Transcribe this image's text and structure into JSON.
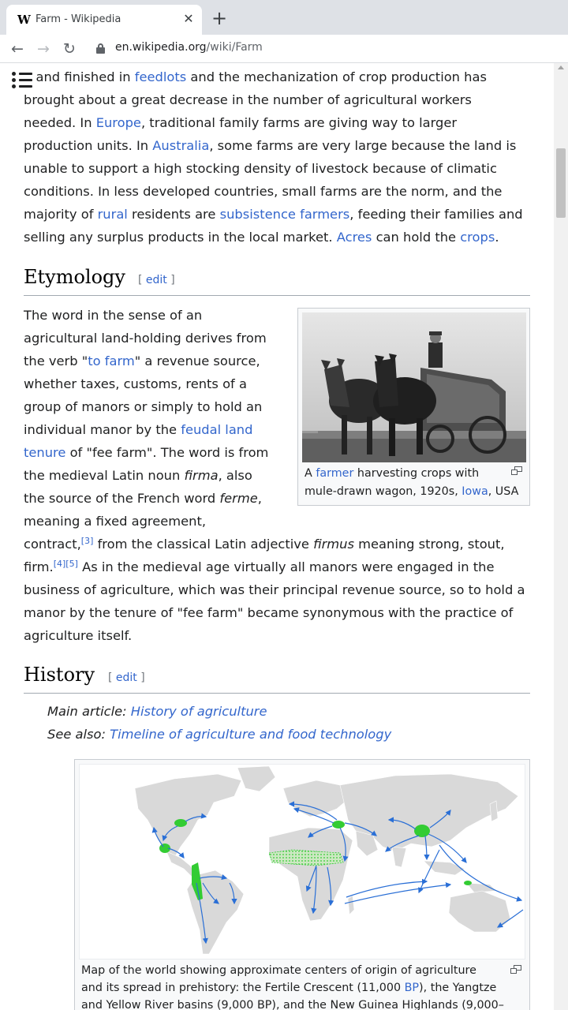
{
  "browser": {
    "tab_favicon": "W",
    "tab_title": "Farm - Wikipedia",
    "tab_close": "✕",
    "new_tab": "+",
    "back": "←",
    "forward": "→",
    "reload": "↻",
    "url_domain": "en.wikipedia.org",
    "url_path": "/wiki/Farm"
  },
  "intro": {
    "l1": [
      "d and finished in ",
      "feedlots",
      " and the mechanization of crop production has"
    ],
    "l2": "brought about a great decrease in the number of agricultural workers",
    "l3": [
      "needed. In ",
      "Europe",
      ", traditional family farms are giving way to larger"
    ],
    "l4": [
      "production units. In ",
      "Australia",
      ", some farms are very large because the land is"
    ],
    "l5": "unable to support a high stocking density of livestock because of climatic",
    "l6": "conditions. In less developed countries, small farms are the norm, and the",
    "l7": [
      "majority of ",
      "rural",
      " residents are ",
      "subsistence farmers",
      ", feeding their families and"
    ],
    "l8": [
      "selling any surplus products in the local market. ",
      "Acres",
      " can hold the ",
      "crops",
      "."
    ]
  },
  "etymology": {
    "heading": "Etymology",
    "edit_open": "[",
    "edit_label": "edit",
    "edit_close": "]",
    "n1": "The word in the sense of an",
    "n2": "agricultural land-holding derives from",
    "n3": [
      "the verb \"",
      "to farm",
      "\" a revenue source,"
    ],
    "n4": "whether taxes, customs, rents of a",
    "n5": "group of manors or simply to hold an",
    "n6": [
      "individual manor by the ",
      "feudal land"
    ],
    "n7": [
      "tenure",
      " of \"fee farm\". The word is from"
    ],
    "n8": [
      "the medieval Latin noun ",
      "firma",
      ", also"
    ],
    "n9": [
      "the source of the French word ",
      "ferme",
      ","
    ],
    "n10": "meaning a fixed agreement,",
    "w1": [
      "contract,",
      "[3]",
      " from the classical Latin adjective ",
      "firmus",
      " meaning strong, stout,"
    ],
    "w2": [
      "firm.",
      "[4]",
      "[5]",
      " As in the medieval age virtually all manors were engaged in the"
    ],
    "w3": "business of agriculture, which was their principal revenue source, so to hold a",
    "w4": "manor by the tenure of \"fee farm\" became synonymous with the practice of",
    "w5": "agriculture itself.",
    "figure_caption": {
      "c1": [
        "A ",
        "farmer",
        " harvesting crops with"
      ],
      "c2": [
        "mule-drawn wagon, 1920s, ",
        "Iowa",
        ", USA"
      ]
    }
  },
  "history": {
    "heading": "History",
    "edit_open": "[",
    "edit_label": "edit",
    "edit_close": "]",
    "main_article_prefix": "Main article: ",
    "main_article_link": "History of agriculture",
    "see_also_prefix": "See also: ",
    "see_also_link": "Timeline of agriculture and food technology",
    "map_caption": {
      "c1": "Map of the world showing approximate centers of origin of agriculture",
      "c2": [
        "and its spread in prehistory: the Fertile Crescent (11,000 ",
        "BP",
        "), the Yangtze"
      ],
      "c3": "and Yellow River basins (9,000 BP), and the New Guinea Highlands (9,000–"
    }
  },
  "colors": {
    "link": "#3366cc",
    "text": "#202122",
    "origin_green": "#33cc33",
    "spread_arrow": "#2a6fd6"
  },
  "icons": [
    "wikipedia-favicon",
    "close-icon",
    "plus-icon",
    "back-arrow-icon",
    "forward-arrow-icon",
    "reload-icon",
    "lock-icon",
    "table-of-contents-icon",
    "magnify-icon"
  ]
}
